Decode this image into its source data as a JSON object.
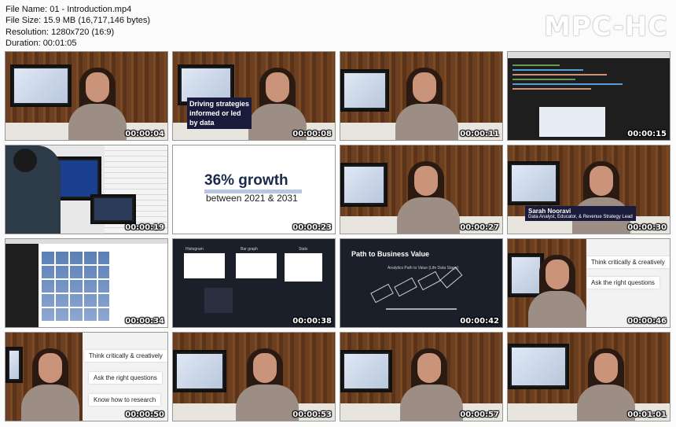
{
  "info": {
    "file_name": "File Name: 01 - Introduction.mp4",
    "file_size": "File Size: 15.9 MB (16,717,146 bytes)",
    "resolution": "Resolution: 1280x720 (16:9)",
    "duration": "Duration: 00:01:05"
  },
  "logo": "MPC-HC",
  "thumbs": [
    {
      "time": "00:00:04"
    },
    {
      "time": "00:00:08",
      "caption": [
        "Driving strategies",
        "informed or led",
        "by data"
      ]
    },
    {
      "time": "00:00:11"
    },
    {
      "time": "00:00:15"
    },
    {
      "time": "00:00:19"
    },
    {
      "time": "00:00:23",
      "headline": "36% growth",
      "subline": "between 2021 & 2031"
    },
    {
      "time": "00:00:27"
    },
    {
      "time": "00:00:30",
      "name": "Sarah Nooravi",
      "role": "Data Analyst, Educator, & Revenue Strategy Lead"
    },
    {
      "time": "00:00:34"
    },
    {
      "time": "00:00:38",
      "chart_titles": [
        "Histogram",
        "Bar graph",
        "Stats"
      ]
    },
    {
      "time": "00:00:42",
      "title": "Path to Business Value",
      "subtitle": "Analytics Path to Value (Life Data Stage)"
    },
    {
      "time": "00:00:46",
      "captions": [
        "Think critically & creatively",
        "Ask the right questions"
      ]
    },
    {
      "time": "00:00:50",
      "captions": [
        "Think critically & creatively",
        "Ask the right questions",
        "Know how to research"
      ]
    },
    {
      "time": "00:00:53"
    },
    {
      "time": "00:00:57"
    },
    {
      "time": "00:01:01"
    }
  ]
}
